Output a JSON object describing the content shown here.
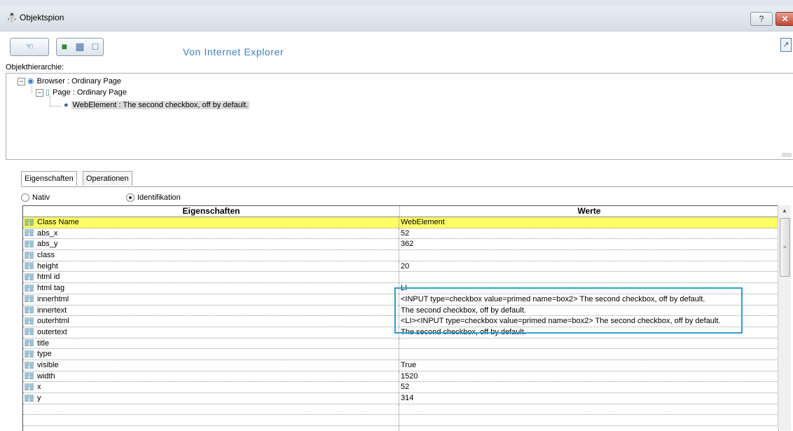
{
  "window": {
    "title": "Objektspion",
    "help_label": "?",
    "close_label": "✕"
  },
  "toolbar": {
    "source_label": "Von Internet Explorer"
  },
  "hierarchy": {
    "label": "Objekthierarchie:",
    "nodes": [
      {
        "text": "Browser : Ordinary Page",
        "icon": "browser-icon",
        "expander": "−"
      },
      {
        "text": "Page : Ordinary Page",
        "icon": "page-icon",
        "expander": "−"
      },
      {
        "text": "WebElement :  The second checkbox, off by default.",
        "icon": "web-element-icon"
      }
    ]
  },
  "tabs": [
    "Eigenschaften",
    "Operationen"
  ],
  "radios": [
    {
      "label": "Nativ",
      "checked": false
    },
    {
      "label": "Identifikation",
      "checked": true
    }
  ],
  "grid": {
    "headers": [
      "Eigenschaften",
      "Werte"
    ],
    "rows": [
      {
        "name": "Class Name",
        "value": "WebElement",
        "selected": true
      },
      {
        "name": "abs_x",
        "value": "52"
      },
      {
        "name": "abs_y",
        "value": "362"
      },
      {
        "name": "class",
        "value": ""
      },
      {
        "name": "height",
        "value": "20"
      },
      {
        "name": "html id",
        "value": ""
      },
      {
        "name": "html tag",
        "value": "LI"
      },
      {
        "name": "innerhtml",
        "value": "<INPUT type=checkbox value=primed name=box2> The second checkbox, off by default."
      },
      {
        "name": "innertext",
        "value": " The second checkbox, off by default."
      },
      {
        "name": "outerhtml",
        "value": "<LI><INPUT type=checkbox value=primed name=box2> The second checkbox, off by default."
      },
      {
        "name": "outertext",
        "value": " The second checkbox, off by default."
      },
      {
        "name": "title",
        "value": ""
      },
      {
        "name": "type",
        "value": ""
      },
      {
        "name": "visible",
        "value": "True"
      },
      {
        "name": "width",
        "value": "1520"
      },
      {
        "name": "x",
        "value": "52"
      },
      {
        "name": "y",
        "value": "314"
      },
      {
        "name": "",
        "value": ""
      },
      {
        "name": "",
        "value": ""
      },
      {
        "name": "",
        "value": ""
      },
      {
        "name": "",
        "value": ""
      }
    ]
  },
  "colors": {
    "selected_row": "#ffff66",
    "highlight_box": "#2aa0d6",
    "accent_text": "#3b7fc4"
  }
}
